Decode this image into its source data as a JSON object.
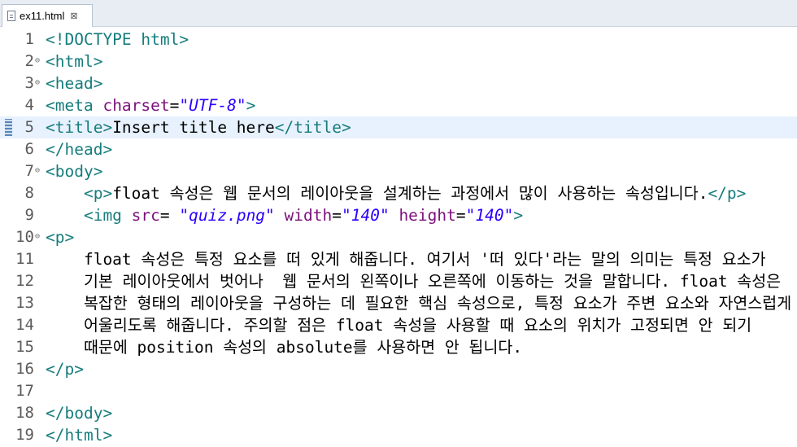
{
  "tab": {
    "filename": "ex11.html",
    "close_glyph": "⊠"
  },
  "icons": {
    "file": "html-file-icon",
    "close": "close-icon",
    "fold": "fold-minus-icon"
  },
  "colors": {
    "tag": "#167c7c",
    "attribute": "#7b117b",
    "value": "#2a00ff",
    "text": "#000000",
    "current_line": "#e8f2fe",
    "line_number": "#5a5a5a"
  },
  "editor": {
    "current_line": 5,
    "lines": [
      {
        "num": "1",
        "segments": [
          {
            "t": "<!DOCTYPE html>",
            "c": "tag"
          }
        ]
      },
      {
        "num": "2",
        "fold": true,
        "segments": [
          {
            "t": "<html>",
            "c": "tag"
          }
        ]
      },
      {
        "num": "3",
        "fold": true,
        "segments": [
          {
            "t": "<head>",
            "c": "tag"
          }
        ]
      },
      {
        "num": "4",
        "segments": [
          {
            "t": "<meta ",
            "c": "tag"
          },
          {
            "t": "charset",
            "c": "attr"
          },
          {
            "t": "=",
            "c": "txt"
          },
          {
            "t": "\"UTF-8\"",
            "c": "val"
          },
          {
            "t": ">",
            "c": "tag"
          }
        ]
      },
      {
        "num": "5",
        "segments": [
          {
            "t": "<title>",
            "c": "tag"
          },
          {
            "t": "Insert title here",
            "c": "txt"
          },
          {
            "t": "</title>",
            "c": "tag"
          }
        ]
      },
      {
        "num": "6",
        "segments": [
          {
            "t": "</head>",
            "c": "tag"
          }
        ]
      },
      {
        "num": "7",
        "fold": true,
        "segments": [
          {
            "t": "<body>",
            "c": "tag"
          }
        ]
      },
      {
        "num": "8",
        "segments": [
          {
            "t": "    <p>",
            "c": "tag"
          },
          {
            "t": "float 속성은 웹 문서의 레이아웃을 설계하는 과정에서 많이 사용하는 속성입니다.",
            "c": "txt"
          },
          {
            "t": "</p>",
            "c": "tag"
          }
        ]
      },
      {
        "num": "9",
        "segments": [
          {
            "t": "    <img ",
            "c": "tag"
          },
          {
            "t": "src",
            "c": "attr"
          },
          {
            "t": "= ",
            "c": "txt"
          },
          {
            "t": "\"quiz.png\"",
            "c": "val"
          },
          {
            "t": " width",
            "c": "attr"
          },
          {
            "t": "=",
            "c": "txt"
          },
          {
            "t": "\"140\"",
            "c": "val"
          },
          {
            "t": " height",
            "c": "attr"
          },
          {
            "t": "=",
            "c": "txt"
          },
          {
            "t": "\"140\"",
            "c": "val"
          },
          {
            "t": ">",
            "c": "tag"
          }
        ]
      },
      {
        "num": "10",
        "fold": true,
        "segments": [
          {
            "t": "<p>",
            "c": "tag"
          }
        ]
      },
      {
        "num": "11",
        "segments": [
          {
            "t": "    float 속성은 특정 요소를 떠 있게 해줍니다. 여기서 '떠 있다'라는 말의 의미는 특정 요소가",
            "c": "txt"
          }
        ]
      },
      {
        "num": "12",
        "segments": [
          {
            "t": "    기본 레이아웃에서 벗어나  웹 문서의 왼쪽이나 오른쪽에 이동하는 것을 말합니다. float 속성은",
            "c": "txt"
          }
        ]
      },
      {
        "num": "13",
        "segments": [
          {
            "t": "    복잡한 형태의 레이아웃을 구성하는 데 필요한 핵심 속성으로, 특정 요소가 주변 요소와 자연스럽게",
            "c": "txt"
          }
        ]
      },
      {
        "num": "14",
        "segments": [
          {
            "t": "    어울리도록 해줍니다. 주의할 점은 float 속성을 사용할 때 요소의 위치가 고정되면 안 되기",
            "c": "txt"
          }
        ]
      },
      {
        "num": "15",
        "segments": [
          {
            "t": "    때문에 position 속성의 absolute를 사용하면 안 됩니다.",
            "c": "txt"
          }
        ]
      },
      {
        "num": "16",
        "segments": [
          {
            "t": "</p>",
            "c": "tag"
          }
        ]
      },
      {
        "num": "17",
        "segments": []
      },
      {
        "num": "18",
        "segments": [
          {
            "t": "</body>",
            "c": "tag"
          }
        ]
      },
      {
        "num": "19",
        "segments": [
          {
            "t": "</html>",
            "c": "tag"
          }
        ]
      }
    ]
  }
}
